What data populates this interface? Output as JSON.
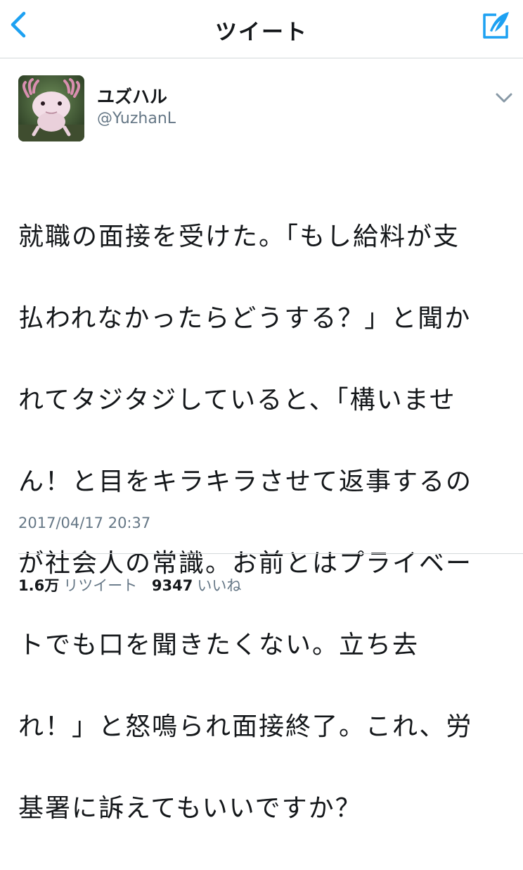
{
  "nav": {
    "title": "ツイート",
    "back_icon": "chevron-left-icon",
    "compose_icon": "compose-quill-icon"
  },
  "user": {
    "display_name": "ユズハル",
    "handle": "@YuzhanL",
    "avatar_icon": "axolotl-avatar",
    "menu_icon": "chevron-down-icon"
  },
  "tweet": {
    "text": "就職の面接を受けた。「もし給料が支払われなかったらどうする？」と聞かれてタジタジしていると、「構いません！と目をキラキラさせて返事するのが社会人の常識。お前とはプライベートでも口を聞きたくない。立ち去れ！」と怒鳴られ面接終了。これ、労基署に訴えてもいいですか？",
    "lines": [
      "就職の面接を受けた。「もし給料が支",
      "払われなかったらどうする？」と聞か",
      "れてタジタジしていると、「構いませ",
      "ん！と目をキラキラさせて返事するの",
      "が社会人の常識。お前とはプライベー",
      "トでも口を聞きたくない。立ち去",
      "れ！」と怒鳴られ面接終了。これ、労",
      "基署に訴えてもいいですか？"
    ],
    "timestamp": "2017/04/17 20:37"
  },
  "stats": {
    "retweets_count": "1.6万",
    "retweets_label": "リツイート",
    "likes_count": "9347",
    "likes_label": "いいね"
  },
  "colors": {
    "accent": "#1da1f2",
    "text": "#14171a",
    "secondary": "#657786",
    "divider": "#d4d8db"
  }
}
